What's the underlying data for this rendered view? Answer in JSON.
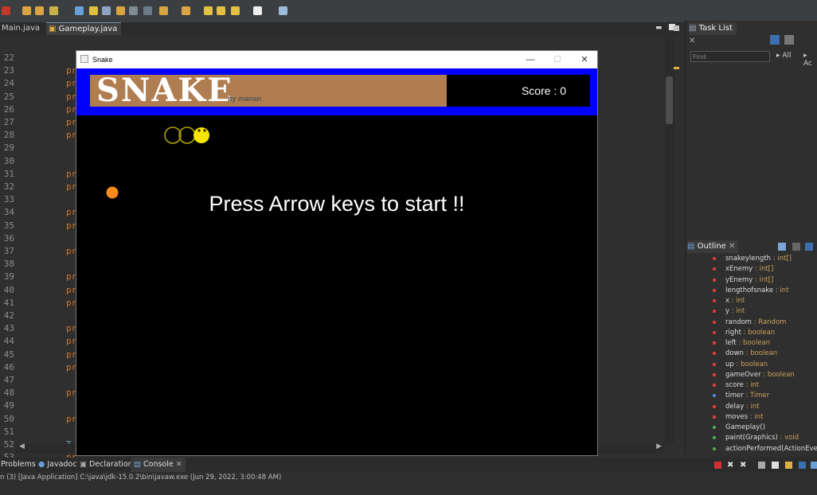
{
  "editor": {
    "tabs": [
      {
        "label": "Main.java"
      },
      {
        "label": "Gameplay.java"
      }
    ],
    "line_numbers": [
      "22",
      "23",
      "24",
      "25",
      "26",
      "27",
      "28",
      "29",
      "30",
      "31",
      "32",
      "33",
      "34",
      "35",
      "36",
      "37",
      "38",
      "39",
      "40",
      "41",
      "42",
      "43",
      "44",
      "45",
      "46",
      "47",
      "48",
      "49",
      "50",
      "51",
      "52",
      "53"
    ],
    "visible_keyword_fragment": "pr",
    "partial_fragment_line52": "T"
  },
  "tasklist": {
    "tab_label": "Task List",
    "find_placeholder": "Find",
    "all_label": "All",
    "ac_label": "Ac"
  },
  "outline": {
    "tab_label": "Outline",
    "items": [
      {
        "name": "snakeylength",
        "type": " : int[]",
        "kind": "field"
      },
      {
        "name": "xEnemy",
        "type": " : int[]",
        "kind": "field"
      },
      {
        "name": "yEnemy",
        "type": " : int[]",
        "kind": "field"
      },
      {
        "name": "lengthofsnake",
        "type": " : int",
        "kind": "field"
      },
      {
        "name": "x",
        "type": " : int",
        "kind": "field"
      },
      {
        "name": "y",
        "type": " : int",
        "kind": "field"
      },
      {
        "name": "random",
        "type": " : Random",
        "kind": "field"
      },
      {
        "name": "right",
        "type": " : boolean",
        "kind": "field"
      },
      {
        "name": "left",
        "type": " : boolean",
        "kind": "field"
      },
      {
        "name": "down",
        "type": " : boolean",
        "kind": "field"
      },
      {
        "name": "up",
        "type": " : boolean",
        "kind": "field"
      },
      {
        "name": "gameOver",
        "type": " : boolean",
        "kind": "field"
      },
      {
        "name": "score",
        "type": " : int",
        "kind": "field"
      },
      {
        "name": "timer",
        "type": " : Timer",
        "kind": "field"
      },
      {
        "name": "delay",
        "type": " : int",
        "kind": "field"
      },
      {
        "name": "moves",
        "type": " : int",
        "kind": "field"
      },
      {
        "name": "Gameplay()",
        "type": "",
        "kind": "constructor"
      },
      {
        "name": "paint(Graphics)",
        "type": " : void",
        "kind": "method"
      },
      {
        "name": "actionPerformed(ActionEvent",
        "type": "",
        "kind": "method"
      }
    ]
  },
  "bottom": {
    "tabs": [
      {
        "label": "Problems"
      },
      {
        "label": "Javadoc"
      },
      {
        "label": "Declaration"
      },
      {
        "label": "Console"
      }
    ],
    "console_line": "n (3) [Java Application] C:\\java\\jdk-15.0.2\\bin\\javaw.exe  (Jun 29, 2022, 3:00:48 AM)"
  },
  "snake_window": {
    "title": "Snake",
    "minimize": "—",
    "maximize": "☐",
    "close": "✕",
    "logo": "SNAKE",
    "byline": "by manan",
    "score": "Score : 0",
    "start_message": "Press Arrow keys to start !!"
  },
  "colors": {
    "snake_head": "#f5e600",
    "snake_body_outline": "#b8a800",
    "enemy": "#ff8c1a",
    "banner": "#b07d50",
    "frame_blue": "#0000ff"
  }
}
